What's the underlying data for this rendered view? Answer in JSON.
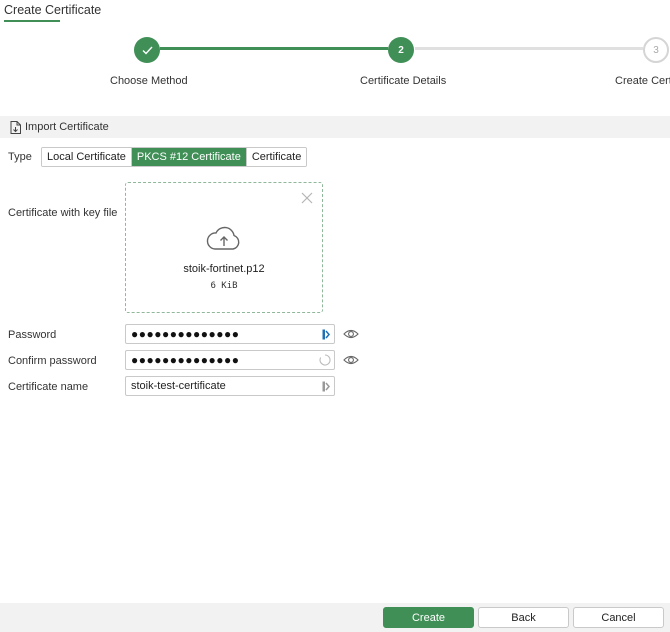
{
  "header": {
    "title": "Create Certificate"
  },
  "stepper": {
    "steps": [
      {
        "label": "Choose Method",
        "number": "",
        "state": "done"
      },
      {
        "label": "Certificate Details",
        "number": "2",
        "state": "active"
      },
      {
        "label": "Create Certi",
        "number": "3",
        "state": "todo"
      }
    ]
  },
  "section": {
    "title": "Import Certificate",
    "icon": "document-import-icon"
  },
  "form": {
    "type_label": "Type",
    "type_options": [
      "Local Certificate",
      "PKCS #12 Certificate",
      "Certificate"
    ],
    "type_selected": "PKCS #12 Certificate",
    "keyfile_label": "Certificate with key file",
    "file": {
      "name": "stoik-fortinet.p12",
      "size": "6 KiB"
    },
    "password_label": "Password",
    "password_value": "●●●●●●●●●●●●●●",
    "confirm_label": "Confirm password",
    "confirm_value": "●●●●●●●●●●●●●●",
    "name_label": "Certificate name",
    "name_value": "stoik-test-certificate"
  },
  "footer": {
    "create": "Create",
    "back": "Back",
    "cancel": "Cancel"
  },
  "colors": {
    "accent": "#3f8f56",
    "border": "#c9c9c9",
    "panel": "#f2f2f2"
  }
}
